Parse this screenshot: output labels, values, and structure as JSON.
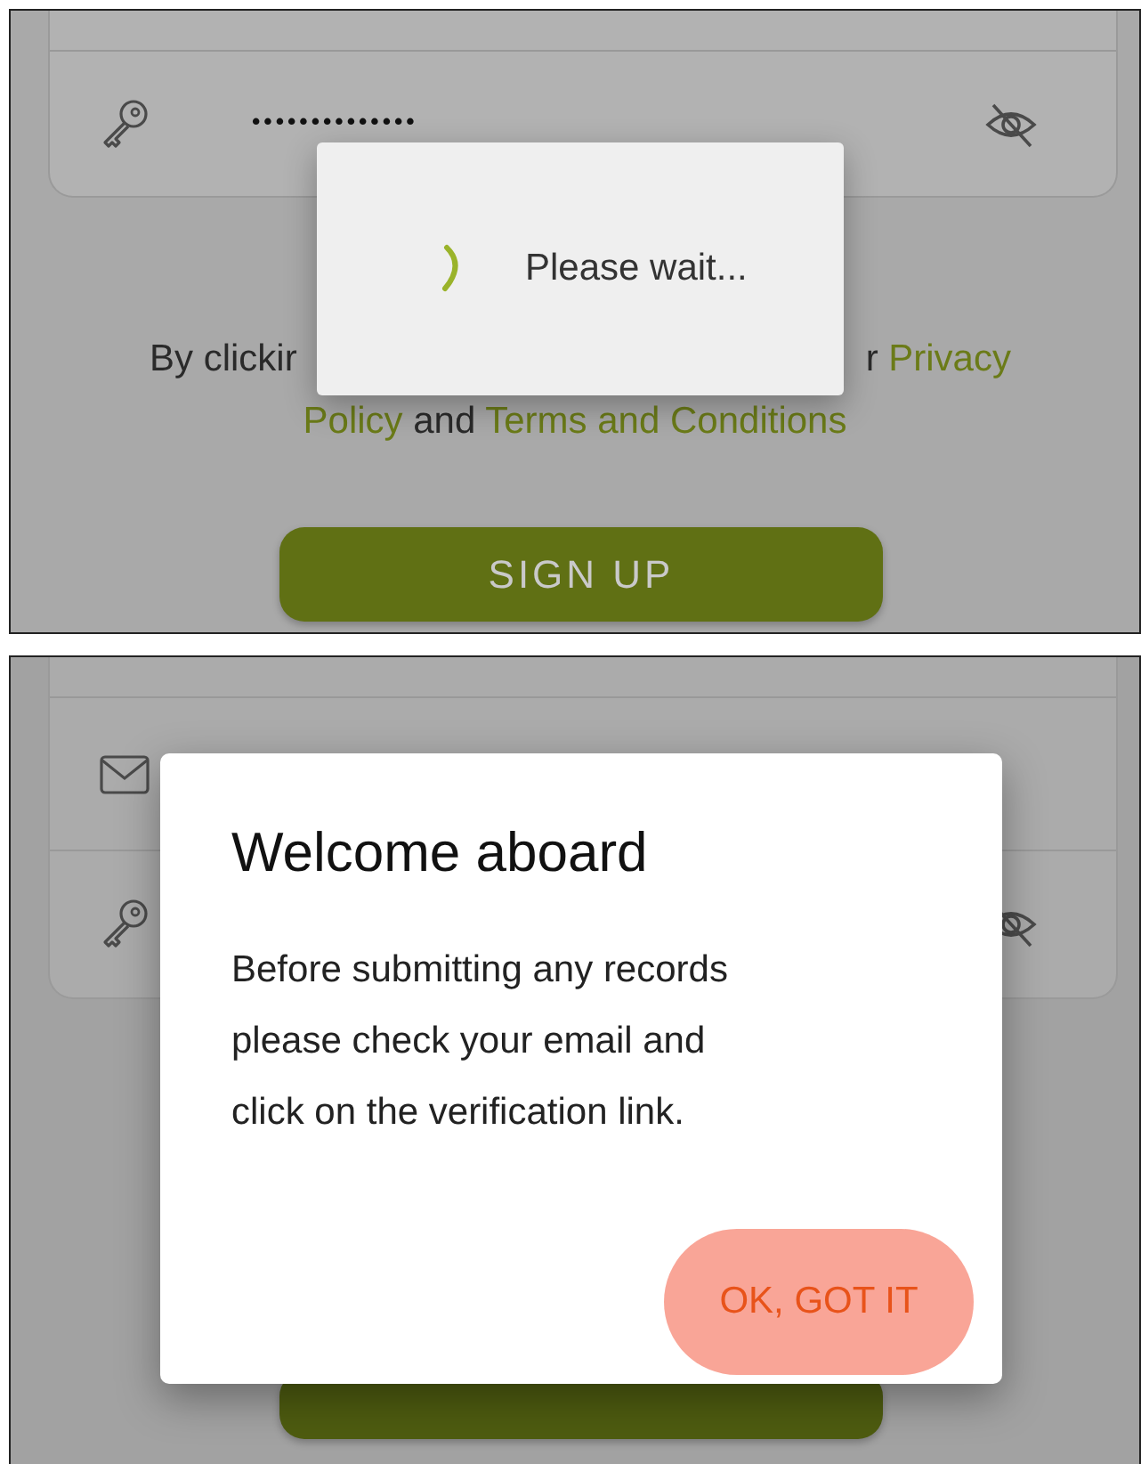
{
  "screens": [
    {
      "kind": "loading",
      "form_rows": [
        {
          "kind": "blank"
        },
        {
          "kind": "password",
          "value": "••••••••••••••"
        }
      ],
      "terms": {
        "line_1_left": "By clickir",
        "line_1_right": "r",
        "line_1_link": "Privacy",
        "line_2": [
          {
            "text": "Policy",
            "link": true
          },
          {
            "text": " and ",
            "link": false
          },
          {
            "text": "Terms and Conditions",
            "link": true
          }
        ]
      },
      "sign_up_button": {
        "label": "SIGN UP"
      },
      "dialog": {
        "message": "Please wait..."
      }
    },
    {
      "kind": "alert",
      "form_rows": [
        {
          "kind": "blank"
        },
        {
          "kind": "email"
        },
        {
          "kind": "password"
        }
      ],
      "dialog": {
        "title": "Welcome aboard",
        "message": "Before submitting any records please check your email and click on the verification link.",
        "button": "OK, GOT IT"
      }
    }
  ]
}
